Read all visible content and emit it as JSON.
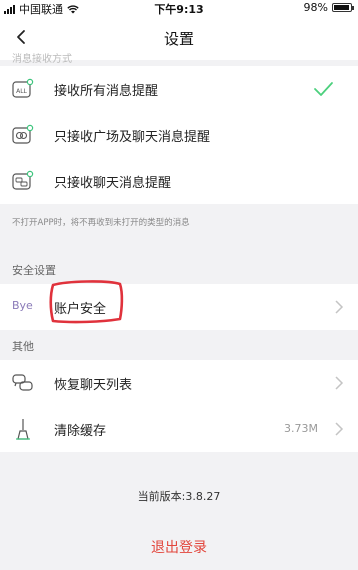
{
  "status_bar": {
    "carrier": "中国联通",
    "time": "下午9:13",
    "battery": "98%"
  },
  "nav": {
    "title": "设置"
  },
  "faded_header": "消息接收方式",
  "notification_options": [
    {
      "label": "接收所有消息提醒",
      "icon": "all-messages-icon",
      "selected": true
    },
    {
      "label": "只接收广场及聊天消息提醒",
      "icon": "square-chat-icon",
      "selected": false
    },
    {
      "label": "只接收聊天消息提醒",
      "icon": "chat-only-icon",
      "selected": false
    }
  ],
  "notification_note": "不打开APP时，将不再收到未打开的类型的消息",
  "security_section": {
    "title": "安全设置",
    "item_label": "账户安全",
    "icon_text": "Bye"
  },
  "other_section": {
    "title": "其他",
    "items": [
      {
        "label": "恢复聊天列表",
        "icon": "chat-bubbles-icon",
        "value": ""
      },
      {
        "label": "清除缓存",
        "icon": "broom-icon",
        "value": "3.73M"
      }
    ]
  },
  "version": "当前版本:3.8.27",
  "logout": "退出登录",
  "colors": {
    "check": "#4cd07d",
    "logout": "#e2463c",
    "annotation": "#e0323c"
  }
}
